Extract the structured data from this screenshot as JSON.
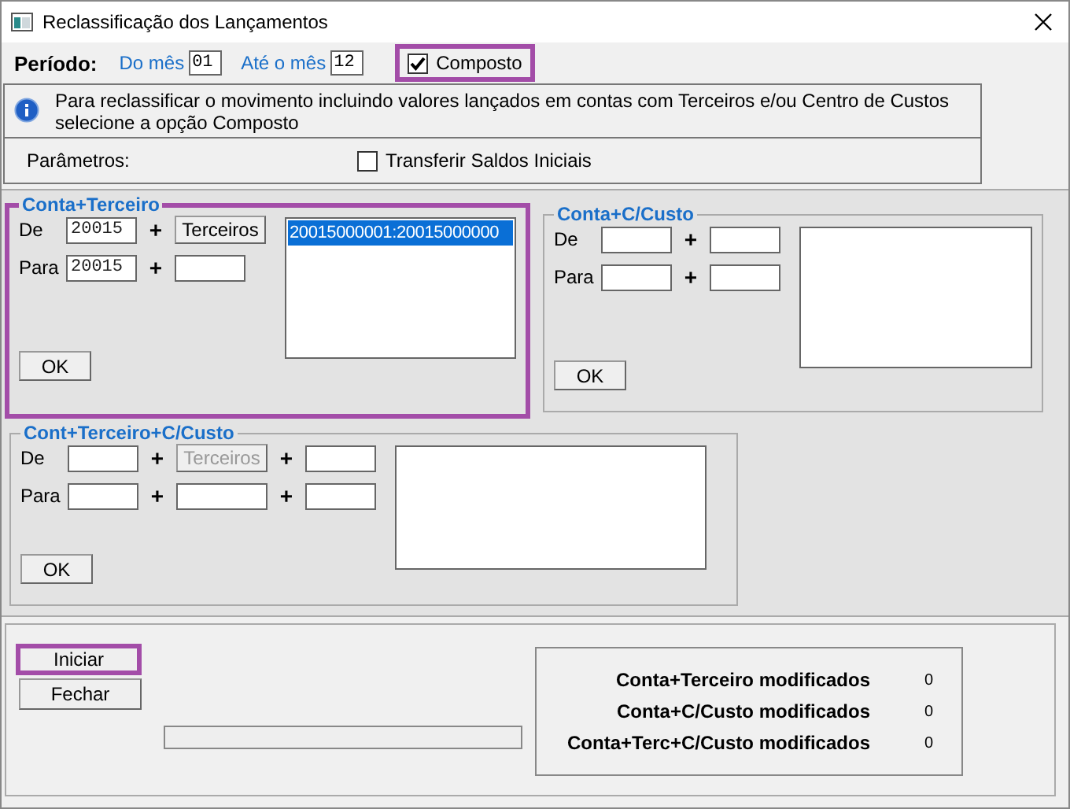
{
  "window": {
    "title": "Reclassificação dos Lançamentos"
  },
  "period": {
    "label": "Período:",
    "from_label": "Do mês",
    "from_value": "01",
    "to_label": "Até o mês",
    "to_value": "12",
    "composto": {
      "label": "Composto",
      "checked": true,
      "highlighted": true
    }
  },
  "info": "Para reclassificar o movimento incluindo valores lançados em contas com Terceiros e/ou Centro de Custos selecione a opção Composto",
  "parameters": {
    "label": "Parâmetros:",
    "transfer": {
      "label": "Transferir Saldos Iniciais",
      "checked": false
    }
  },
  "groups": [
    {
      "title": "Conta+Terceiro",
      "highlighted": true,
      "rows": [
        {
          "label": "De",
          "fields": [
            {
              "kind": "input",
              "value": "20015"
            },
            {
              "kind": "plus",
              "text": "+"
            },
            {
              "kind": "button",
              "label": "Terceiros",
              "disabled": false
            }
          ]
        },
        {
          "label": "Para",
          "fields": [
            {
              "kind": "input",
              "value": "20015"
            },
            {
              "kind": "plus",
              "text": "+"
            },
            {
              "kind": "input"
            }
          ]
        }
      ],
      "list": [
        {
          "text": "20015000001:20015000000",
          "selected": true
        }
      ],
      "ok": "OK"
    },
    {
      "title": "Conta+C/Custo",
      "highlighted": false,
      "rows": [
        {
          "label": "De",
          "fields": [
            {
              "kind": "input"
            },
            {
              "kind": "plus",
              "text": "+"
            },
            {
              "kind": "input"
            }
          ]
        },
        {
          "label": "Para",
          "fields": [
            {
              "kind": "input"
            },
            {
              "kind": "plus",
              "text": "+"
            },
            {
              "kind": "input"
            }
          ]
        }
      ],
      "ok": "OK"
    },
    {
      "title": "Cont+Terceiro+C/Custo",
      "highlighted": false,
      "rows": [
        {
          "label": "De",
          "fields": [
            {
              "kind": "input"
            },
            {
              "kind": "plus",
              "text": "+"
            },
            {
              "kind": "button",
              "label": "Terceiros",
              "disabled": true
            },
            {
              "kind": "plus",
              "text": "+"
            },
            {
              "kind": "input"
            }
          ]
        },
        {
          "label": "Para",
          "fields": [
            {
              "kind": "input"
            },
            {
              "kind": "plus",
              "text": "+"
            },
            {
              "kind": "input",
              "wide": true
            },
            {
              "kind": "plus",
              "text": "+"
            },
            {
              "kind": "input"
            }
          ]
        }
      ],
      "ok": "OK"
    }
  ],
  "buttons": [
    {
      "label": "Iniciar",
      "highlighted": true
    },
    {
      "label": "Fechar",
      "highlighted": false
    }
  ],
  "progress": {
    "level": 0
  },
  "counters": [
    {
      "label": "Conta+Terceiro modificados",
      "value": "0"
    },
    {
      "label": "Conta+C/Custo modificados",
      "value": "0"
    },
    {
      "label": "Conta+Terc+C/Custo modificados",
      "value": "0"
    }
  ]
}
